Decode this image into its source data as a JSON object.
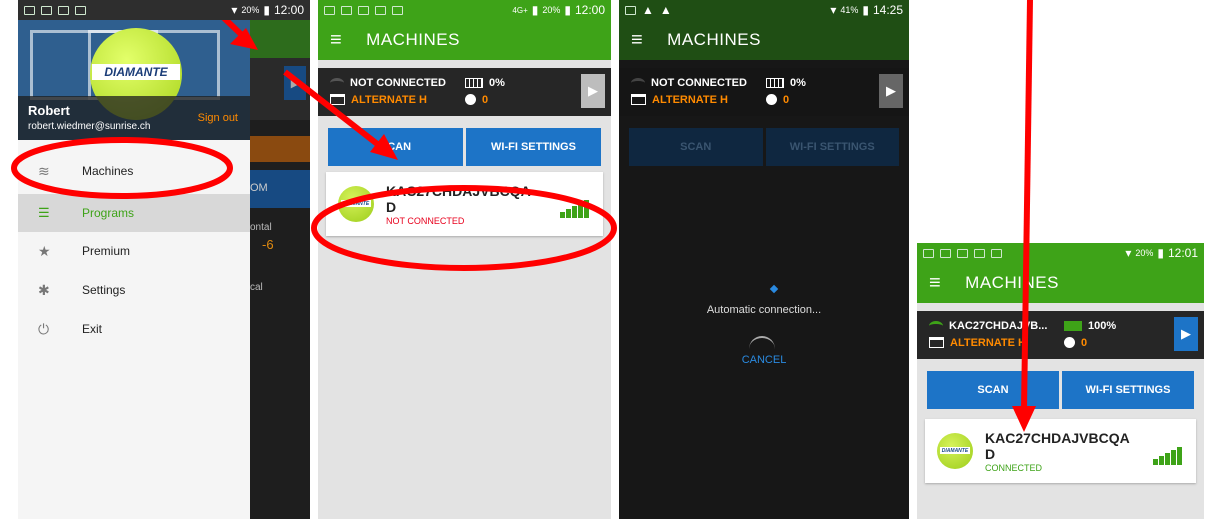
{
  "p1": {
    "time": "12:00",
    "battery": "20%",
    "user": "Robert",
    "email": "robert.wiedmer@sunrise.ch",
    "signout": "Sign out",
    "logo": "DIAMANTE",
    "menu": [
      {
        "label": "Machines",
        "icon": "wifi-icon"
      },
      {
        "label": "Programs",
        "icon": "list-icon"
      },
      {
        "label": "Premium",
        "icon": "star-icon"
      },
      {
        "label": "Settings",
        "icon": "gear-icon"
      },
      {
        "label": "Exit",
        "icon": "power-icon"
      }
    ],
    "bg": {
      "horiz": "ontal",
      "horiz_val": "-6",
      "vert": "cal",
      "om": "OM"
    }
  },
  "p2": {
    "time": "12:00",
    "battery": "20%",
    "network": "4G+",
    "title": "MACHINES",
    "status": "NOT CONNECTED",
    "battery_level": "0%",
    "program": "ALTERNATE H",
    "balls": "0",
    "scan": "SCAN",
    "wifi_settings": "WI-FI SETTINGS",
    "machine_name": "KAC27CHDAJVBCQAD",
    "machine_status": "NOT CONNECTED"
  },
  "p3": {
    "time": "14:25",
    "battery": "41%",
    "title": "MACHINES",
    "status": "NOT CONNECTED",
    "battery_level": "0%",
    "program": "ALTERNATE H",
    "balls": "0",
    "scan": "SCAN",
    "wifi_settings": "WI-FI SETTINGS",
    "auto": "Automatic connection...",
    "cancel": "CANCEL"
  },
  "p4": {
    "time": "12:01",
    "battery": "20%",
    "title": "MACHINES",
    "status": "KAC27CHDAJVB...",
    "battery_level": "100%",
    "program": "ALTERNATE H",
    "balls": "0",
    "scan": "SCAN",
    "wifi_settings": "WI-FI SETTINGS",
    "machine_name": "KAC27CHDAJVBCQAD",
    "machine_status": "CONNECTED"
  },
  "colors": {
    "green": "#3ea318",
    "blue": "#1d74c7",
    "orange": "#ff8a00",
    "red": "#e8001c",
    "annotation": "#ff0000"
  }
}
